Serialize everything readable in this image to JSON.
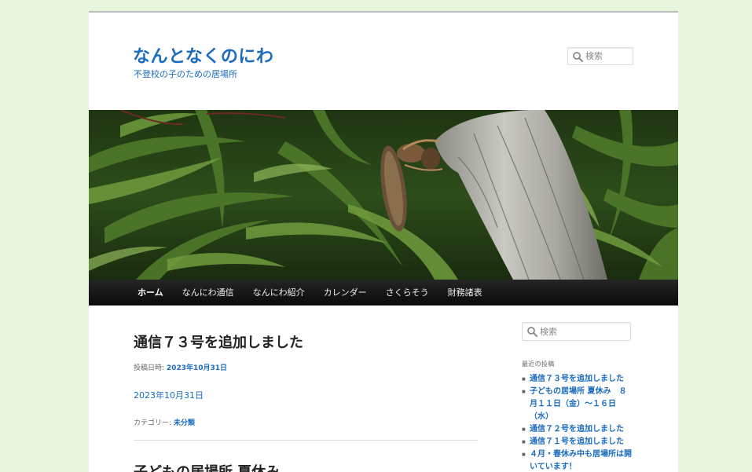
{
  "site": {
    "title": "なんとなくのにわ",
    "description": "不登校の子のための居場所"
  },
  "search": {
    "placeholder": "検索"
  },
  "nav": {
    "items": [
      "ホーム",
      "なんにわ通信",
      "なんにわ紹介",
      "カレンダー",
      "さくらそう",
      "財務諸表"
    ],
    "current": "ホーム"
  },
  "posts": [
    {
      "title": "通信７３号を追加しました",
      "meta_label": "投稿日時:",
      "date": "2023年10月31日",
      "content": "2023年10月31日",
      "category_label": "カテゴリー:",
      "category": "未分類"
    },
    {
      "title": "子どもの居場所 夏休み"
    }
  ],
  "sidebar": {
    "recent_title": "最近の投稿",
    "recent_posts": [
      "通信７３号を追加しました",
      "子どもの居場所 夏休み　８月１１日（金）～１６日（水）",
      "通信７２号を追加しました",
      "通信７１号を追加しました",
      "４月・春休み中も居場所は開いています！"
    ]
  },
  "colors": {
    "link": "#1b6bbf",
    "background": "#e8f5dc",
    "nav_bg": "#111111"
  }
}
